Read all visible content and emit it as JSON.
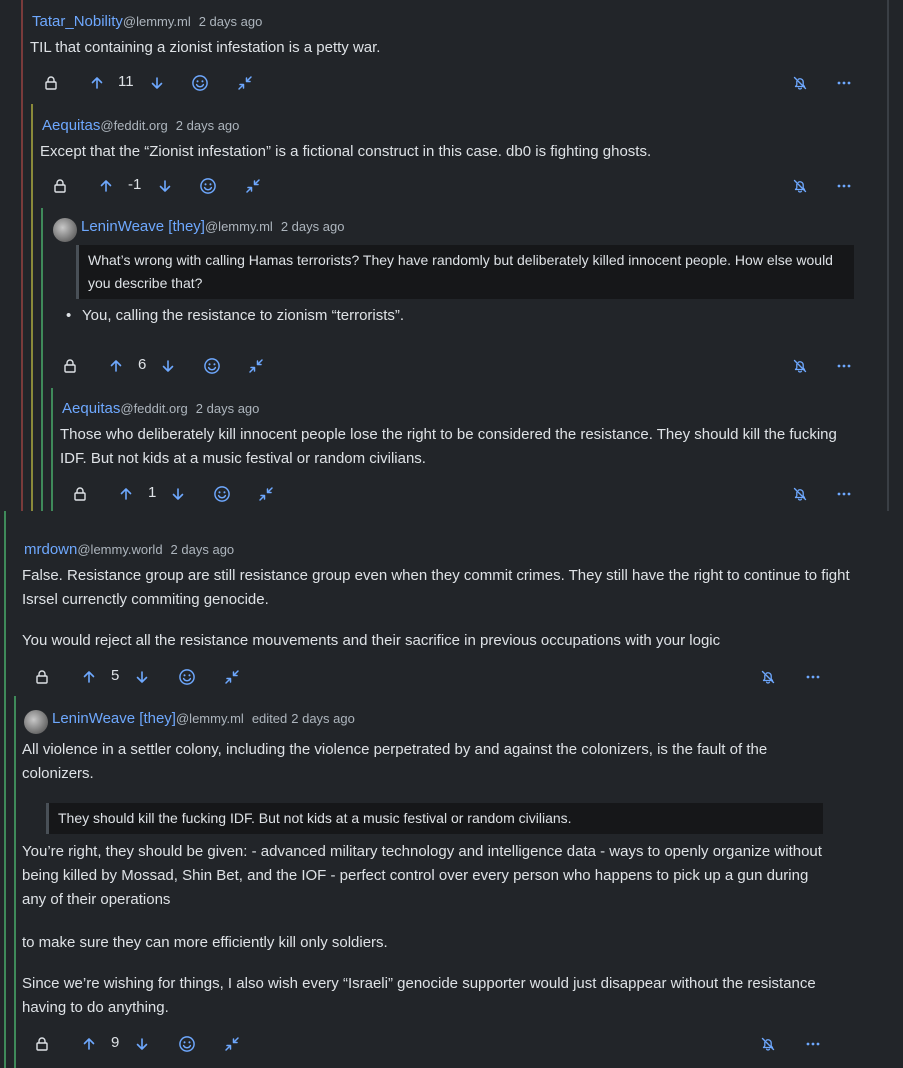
{
  "comments": [
    {
      "user": "Tatar_Nobility",
      "instance": "@lemmy.ml",
      "time": "2 days ago",
      "body": "TIL that containing a zionist infestation is a petty war.",
      "score": "11"
    },
    {
      "user": "Aequitas",
      "instance": "@feddit.org",
      "time": "2 days ago",
      "body": "Except that the “Zionist infestation” is a fictional construct in this case. db0 is fighting ghosts.",
      "score": "-1"
    },
    {
      "user": "LeninWeave [they]",
      "instance": "@lemmy.ml",
      "time": "2 days ago",
      "quote": "What’s wrong with calling Hamas terrorists? They have randomly but deliberately killed innocent people. How else would you describe that?",
      "bullet": "You, calling the resistance to zionism “terrorists”.",
      "score": "6"
    },
    {
      "user": "Aequitas",
      "instance": "@feddit.org",
      "time": "2 days ago",
      "body": "Those who deliberately kill innocent people lose the right to be considered the resistance. They should kill the fucking IDF. But not kids at a music festival or random civilians.",
      "score": "1"
    },
    {
      "user": "mrdown",
      "instance": "@lemmy.world",
      "time": "2 days ago",
      "body1": "False. Resistance group are still resistance group even when they commit crimes. They still have the right to continue to fight Isrsel currenctly commiting genocide.",
      "body2": "You would reject all the resistance mouvements and their sacrifice in previous occupations with your logic",
      "score": "5"
    },
    {
      "user": "LeninWeave [they]",
      "instance": "@lemmy.ml",
      "edited": "edited",
      "time": "2 days ago",
      "body1": "All violence in a settler colony, including the violence perpetrated by and against the colonizers, is the fault of the colonizers.",
      "quote": "They should kill the fucking IDF. But not kids at a music festival or random civilians.",
      "body2": "You’re right, they should be given: - advanced military technology and intelligence data - ways to openly organize without being killed by Mossad, Shin Bet, and the IOF - perfect control over every person who happens to pick up a gun during any of their operations",
      "body3": "to make sure they can more efficiently kill only soldiers.",
      "body4": "Since we’re wishing for things, I also wish every “Israeli” genocide supporter would just disappear without the resistance having to do anything.",
      "score": "9"
    }
  ],
  "icons": {
    "lock": "lock-icon",
    "upvote": "arrow-up-icon",
    "downvote": "arrow-down-icon",
    "react": "smiley-icon",
    "collapse": "collapse-icon",
    "notifications_off": "bell-off-icon",
    "more": "more-icon"
  },
  "colors": {
    "background": "#222529",
    "link": "#6ea8fe",
    "muted": "#adb5bd",
    "quote_bg": "#161719",
    "thread_red": "#7a3b3b",
    "thread_yellow": "#8a8a3a",
    "thread_green": "#3f8a5a"
  }
}
